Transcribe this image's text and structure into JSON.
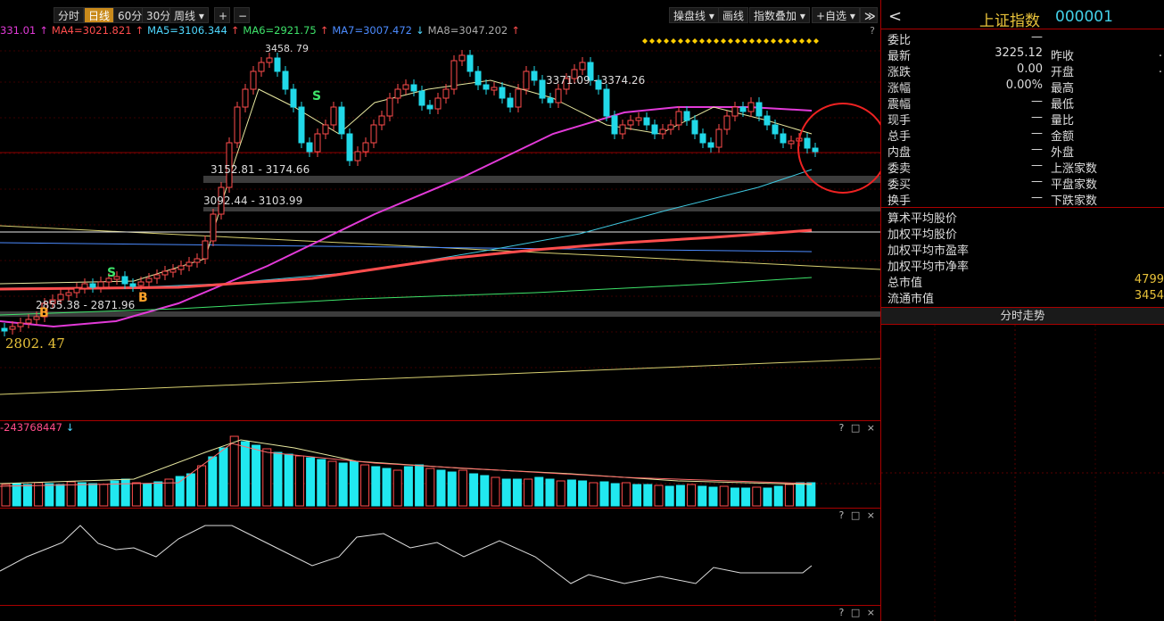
{
  "toolbar": {
    "periods": [
      "分时",
      "日线",
      "60分",
      "30分",
      "周线 ▾"
    ],
    "active": "日线",
    "zoom_in": "+",
    "zoom_out": "−",
    "tools": [
      "操盘线 ▾",
      "画线",
      "指数叠加 ▾",
      "+自选 ▾"
    ],
    "collapse": "≫"
  },
  "ma_legend": [
    {
      "text": "331.01",
      "color": "#e23ad8"
    },
    {
      "text": "↑",
      "color": "#e23ad8"
    },
    {
      "text": "MA4=3021.821",
      "color": "#ff4d4d"
    },
    {
      "text": "↑",
      "color": "#ff4d4d"
    },
    {
      "text": "MA5=3106.344",
      "color": "#4fd8ff"
    },
    {
      "text": "↑",
      "color": "#ff4d4d"
    },
    {
      "text": "MA6=2921.75",
      "color": "#3ee36a"
    },
    {
      "text": "↑",
      "color": "#ff4d4d"
    },
    {
      "text": "MA7=3007.472",
      "color": "#4c8bff"
    },
    {
      "text": "↓",
      "color": "#4fd8ff"
    },
    {
      "text": "MA8=3047.202",
      "color": "#aaaaaa"
    },
    {
      "text": "↑",
      "color": "#ff4d4d"
    }
  ],
  "chart_labels": {
    "high_peak": "3458. 79",
    "zone1": "3371.09 - 3374.26",
    "zone2": "3152.81 - 3174.66",
    "zone3": "3092.44 - 3103.99",
    "zone4": "2855.38 - 2871.96",
    "low_value": "2802. 47",
    "sell_mark": "S",
    "buy_mark": "B"
  },
  "volume_panel": {
    "label": "-243768447",
    "arrow": "↓",
    "controls": "? □ ×"
  },
  "indicator_panel": {
    "controls": "? □ ×"
  },
  "bottom_panel": {
    "controls": "? □ ×"
  },
  "quote": {
    "back": "<",
    "name": "上证指数",
    "code": "000001",
    "rows": [
      {
        "l1": "委比",
        "v1": "—",
        "l2": "",
        "v2": ""
      },
      {
        "l1": "最新",
        "v1": "3225.12",
        "l2": "昨收",
        "v2": "."
      },
      {
        "l1": "涨跌",
        "v1": "0.00",
        "l2": "开盘",
        "v2": "."
      },
      {
        "l1": "涨幅",
        "v1": "0.00%",
        "l2": "最高",
        "v2": ""
      },
      {
        "l1": "震幅",
        "v1": "—",
        "l2": "最低",
        "v2": ""
      },
      {
        "l1": "现手",
        "v1": "—",
        "l2": "量比",
        "v2": ""
      },
      {
        "l1": "总手",
        "v1": "—",
        "l2": "金额",
        "v2": ""
      },
      {
        "l1": "内盘",
        "v1": "—",
        "l2": "外盘",
        "v2": ""
      },
      {
        "l1": "委卖",
        "v1": "—",
        "l2": "上涨家数",
        "v2": ""
      },
      {
        "l1": "委买",
        "v1": "—",
        "l2": "平盘家数",
        "v2": ""
      },
      {
        "l1": "换手",
        "v1": "—",
        "l2": "下跌家数",
        "v2": ""
      }
    ],
    "stats": [
      {
        "l": "算术平均股价",
        "v": ""
      },
      {
        "l": "加权平均股价",
        "v": ""
      },
      {
        "l": "加权平均市盈率",
        "v": ""
      },
      {
        "l": "加权平均市净率",
        "v": ""
      },
      {
        "l": "总市值",
        "v": "4799"
      },
      {
        "l": "流通市值",
        "v": "3454"
      }
    ],
    "intraday_header": "分时走势"
  }
}
